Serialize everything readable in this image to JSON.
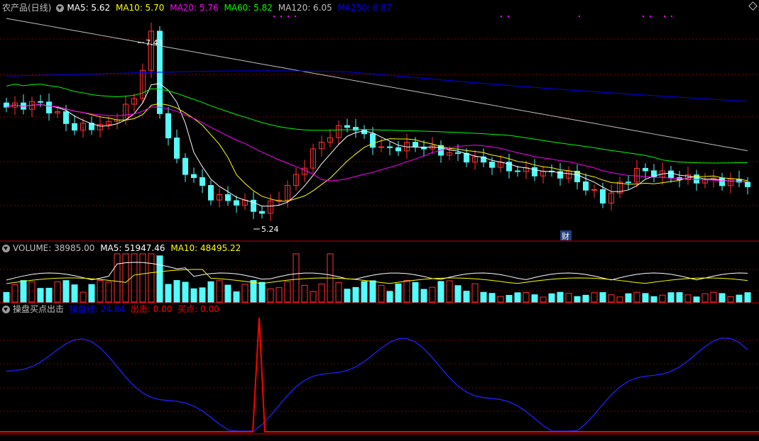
{
  "panel_main": {
    "title": "农产品(日线)",
    "ma5_label": "MA5: 5.62",
    "ma10_label": "MA10: 5.70",
    "ma20_label": "MA20: 5.76",
    "ma60_label": "MA60: 5.82",
    "ma120_label": "MA120: 6.05",
    "ma250_label": "MA250: 6.87",
    "high_label": "7.43",
    "low_label": "5.24",
    "finance_badge": "财"
  },
  "panel_volume": {
    "volume_label": "VOLUME: 38985.00",
    "ma5_label": "MA5: 51947.46",
    "ma10_label": "MA10: 48495.22"
  },
  "panel_indicator": {
    "name": "操盘买点出击",
    "line_label": "操盘线: 24.84",
    "out_label": "出击: 0.00",
    "buy_label": "买点: 0.00"
  },
  "colors": {
    "up": "#ff3232",
    "down": "#54fcfc",
    "ma5": "#ffffff",
    "ma10": "#ffff00",
    "ma20": "#ff00ff",
    "ma60": "#00ff00",
    "ma120": "#c0c0c0",
    "ma250": "#0000ff",
    "grid": "#800000"
  }
}
